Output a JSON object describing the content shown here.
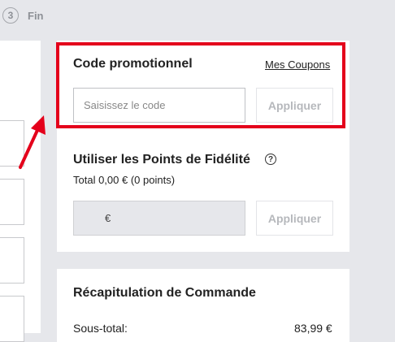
{
  "steps": {
    "current_number": "3",
    "current_label": "Fin"
  },
  "promo": {
    "title": "Code promotionnel",
    "coupons_link": "Mes Coupons",
    "input_placeholder": "Saisissez le code",
    "apply_label": "Appliquer"
  },
  "points": {
    "title": "Utiliser les Points de Fidélité",
    "help_icon": "?",
    "total": "Total 0,00 € (0 points)",
    "currency": "€",
    "apply_label": "Appliquer"
  },
  "summary": {
    "title": "Récapitulation de Commande",
    "subtotal_label": "Sous-total:",
    "subtotal_value": "83,99 €"
  },
  "colors": {
    "highlight": "#e4001b",
    "background": "#e6e7eb"
  }
}
